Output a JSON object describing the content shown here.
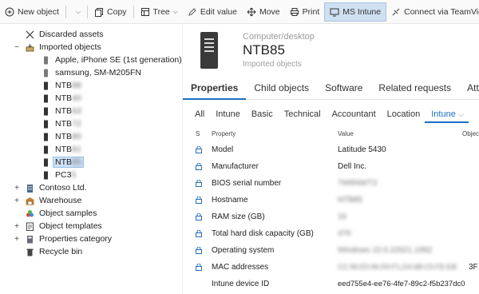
{
  "toolbar": {
    "new_object": "New object",
    "copy": "Copy",
    "tree": "Tree",
    "edit_value": "Edit value",
    "move": "Move",
    "print": "Print",
    "ms_intune": "MS Intune",
    "connect_teamviewer": "Connect via TeamViewer"
  },
  "tree": {
    "discarded": "Discarded assets",
    "imported": "Imported objects",
    "apple": "Apple, iPhone SE (1st generation)",
    "samsung": "samsung, SM-M205FN",
    "ntb_prefix": "NTB",
    "ntb_tail": "85",
    "pc_prefix": "PC3",
    "pc_tail": "5",
    "contoso": "Contoso Ltd.",
    "warehouse": "Warehouse",
    "samples": "Object samples",
    "templates": "Object templates",
    "props_category": "Properties category",
    "recycle": "Recycle bin",
    "expand_plus": "+",
    "collapse_minus": "−"
  },
  "object": {
    "class": "Computer/desktop",
    "name": "NTB85",
    "group": "Imported objects"
  },
  "tabs": [
    "Properties",
    "Child objects",
    "Software",
    "Related requests",
    "Attachments"
  ],
  "subtabs": [
    "All",
    "Intune",
    "Basic",
    "Technical",
    "Accountant",
    "Location",
    "Intune"
  ],
  "columns": {
    "s": "S",
    "property": "Property",
    "value": "Value",
    "object": "Object"
  },
  "properties": [
    {
      "label": "Model",
      "value": "Latitude 5430"
    },
    {
      "label": "Manufacturer",
      "value": "Dell Inc."
    },
    {
      "label": "BIOS serial number",
      "value": "7W6NWT3"
    },
    {
      "label": "Hostname",
      "value": "NTB85"
    },
    {
      "label": "RAM size (GB)",
      "value": "16"
    },
    {
      "label": "Total hard disk capacity (GB)",
      "value": "476"
    },
    {
      "label": "Operating system",
      "value": "Windows 10.0.22621.1992"
    },
    {
      "label": "MAC addresses",
      "value": "CC:96:E5:96:D0:F1,D4:6B:C5:FE:EB:",
      "suffix": "3F"
    },
    {
      "label": "Intune device ID",
      "value": "eed755e4-ee76-4fe7-89c2-f5b237dc0"
    }
  ],
  "colors": {
    "accent": "#1a6fc2",
    "selected_bg": "#cce0f5"
  }
}
